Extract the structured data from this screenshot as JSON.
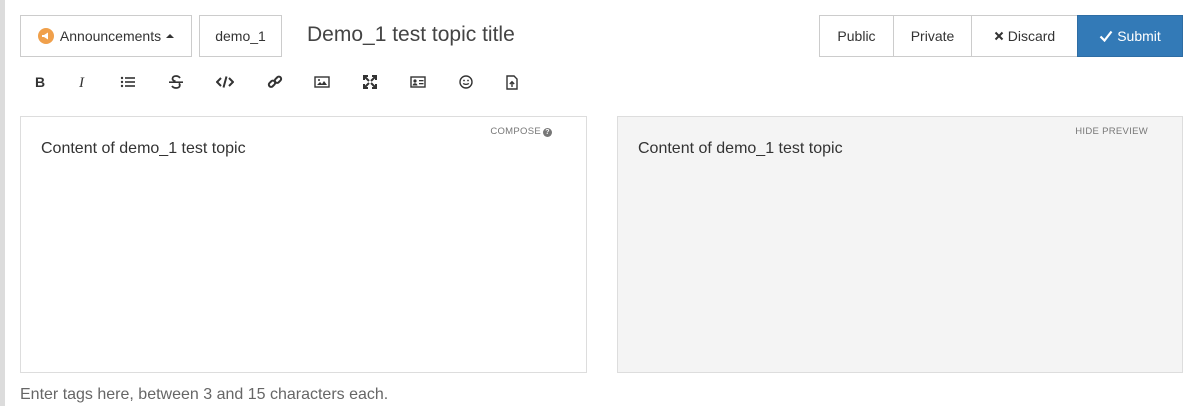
{
  "header": {
    "category_label": "Announcements",
    "category_icon": "megaphone-icon",
    "category_color": "#f0a04b",
    "tag_button": "demo_1",
    "title": "Demo_1 test topic title",
    "actions": {
      "public": "Public",
      "private": "Private",
      "discard": "Discard",
      "submit": "Submit"
    },
    "submit_color": "#337ab7"
  },
  "toolbar": {
    "tools": [
      "bold-icon",
      "italic-icon",
      "list-icon",
      "strikethrough-icon",
      "code-icon",
      "link-icon",
      "image-icon",
      "fullscreen-icon",
      "profile-card-icon",
      "emoji-icon",
      "file-upload-icon"
    ]
  },
  "composer": {
    "label": "COMPOSE",
    "content": "Content of demo_1 test topic"
  },
  "preview": {
    "label": "HIDE PREVIEW",
    "content": "Content of demo_1 test topic"
  },
  "tags": {
    "placeholder": "Enter tags here, between 3 and 15 characters each."
  }
}
